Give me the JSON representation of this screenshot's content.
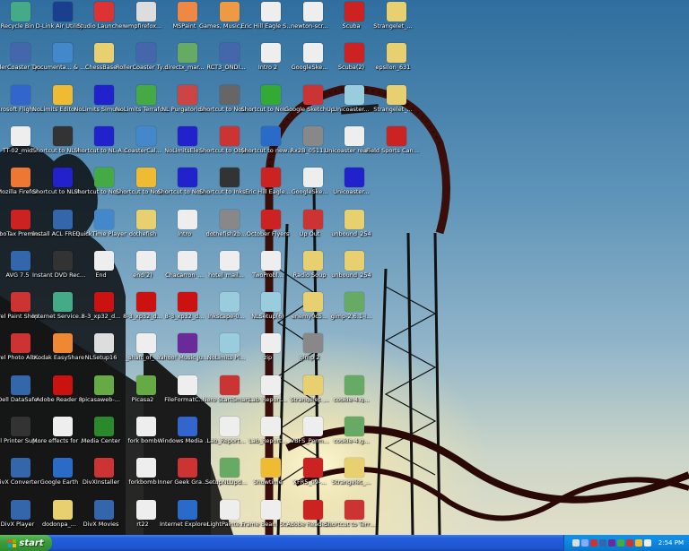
{
  "desktop": {
    "icons": [
      {
        "label": "Recycle Bin",
        "icon": "recycle-bin-icon",
        "color": "#4a8",
        "col": 0,
        "row": 0
      },
      {
        "label": "D-Link Air Utility",
        "icon": "dlink-icon",
        "color": "#1a3f8f",
        "col": 1,
        "row": 0
      },
      {
        "label": "Studio Launcher",
        "icon": "studio-icon",
        "color": "#d33",
        "col": 2,
        "row": 0
      },
      {
        "label": "wmpfirefox...",
        "icon": "window-icon",
        "color": "#ddd",
        "col": 3,
        "row": 0
      },
      {
        "label": "MSPaint",
        "icon": "paint-icon",
        "color": "#e84",
        "col": 4,
        "row": 0
      },
      {
        "label": "Games, Music, & Photos",
        "icon": "folder-icon",
        "color": "#e94",
        "col": 5,
        "row": 0
      },
      {
        "label": "Eric Hill Eagle Service Pr...",
        "icon": "document-icon",
        "color": "#eee",
        "col": 6,
        "row": 0
      },
      {
        "label": "newton-scr...",
        "icon": "document-icon",
        "color": "#eee",
        "col": 7,
        "row": 0
      },
      {
        "label": "Scuba",
        "icon": "pdf-icon",
        "color": "#c22",
        "col": 8,
        "row": 0
      },
      {
        "label": "Strangelet_...",
        "icon": "folder-icon",
        "color": "#e8d070",
        "col": 9,
        "row": 0
      },
      {
        "label": "RollerCoaster Tycoon® 3",
        "icon": "rct-icon",
        "color": "#46a",
        "col": 0,
        "row": 1
      },
      {
        "label": "Documenta... & Support",
        "icon": "help-icon",
        "color": "#48c",
        "col": 1,
        "row": 1
      },
      {
        "label": "ChessBase",
        "icon": "folder-icon",
        "color": "#e8d070",
        "col": 2,
        "row": 1
      },
      {
        "label": "RollerCoaster Tycoon® 3",
        "icon": "rct-icon",
        "color": "#46a",
        "col": 3,
        "row": 1
      },
      {
        "label": "directx_mar...",
        "icon": "setup-icon",
        "color": "#6a6",
        "col": 4,
        "row": 1
      },
      {
        "label": "RCT3_ONDI...",
        "icon": "rct-icon",
        "color": "#46a",
        "col": 5,
        "row": 1
      },
      {
        "label": "Intro 2",
        "icon": "document-icon",
        "color": "#eee",
        "col": 6,
        "row": 1
      },
      {
        "label": "GoogleSke...",
        "icon": "document-icon",
        "color": "#eee",
        "col": 7,
        "row": 1
      },
      {
        "label": "Scuba(2)",
        "icon": "pdf-icon",
        "color": "#c22",
        "col": 8,
        "row": 1
      },
      {
        "label": "epsilon_631",
        "icon": "folder-icon",
        "color": "#e8d070",
        "col": 9,
        "row": 1
      },
      {
        "label": "Microsoft Flight Si...",
        "icon": "plane-icon",
        "color": "#36c",
        "col": 0,
        "row": 2
      },
      {
        "label": "NoLimits Editor 1.6",
        "icon": "helmet-icon",
        "color": "#eb3",
        "col": 1,
        "row": 2
      },
      {
        "label": "NoLimits Simulator 1.6",
        "icon": "track-icon",
        "color": "#22c",
        "col": 2,
        "row": 2
      },
      {
        "label": "NoLimits Terrafor...",
        "icon": "terrain-icon",
        "color": "#4a4",
        "col": 3,
        "row": 2
      },
      {
        "label": "NL Purgatorium",
        "icon": "tools-icon",
        "color": "#c44",
        "col": 4,
        "row": 2
      },
      {
        "label": "Shortcut to NoLimitsCon...",
        "icon": "track-icon",
        "color": "#666",
        "col": 5,
        "row": 2
      },
      {
        "label": "Shortcut to NoLimits Tra...",
        "icon": "track-icon",
        "color": "#3a3",
        "col": 6,
        "row": 2
      },
      {
        "label": "Google SketchUp",
        "icon": "sketchup-icon",
        "color": "#c33",
        "col": 7,
        "row": 2
      },
      {
        "label": "Unicoaster...",
        "icon": "cd-icon",
        "color": "#9cd",
        "col": 8,
        "row": 2
      },
      {
        "label": "Strangelet_...",
        "icon": "folder-icon",
        "color": "#e8d070",
        "col": 9,
        "row": 2
      },
      {
        "label": "TT-02_mid",
        "icon": "document-icon",
        "color": "#eee",
        "col": 0,
        "row": 3
      },
      {
        "label": "Shortcut to NL-AHG ve...",
        "icon": "track-icon",
        "color": "#333",
        "col": 1,
        "row": 3
      },
      {
        "label": "Shortcut to NL-AHG Usa...",
        "icon": "track-icon",
        "color": "#22c",
        "col": 2,
        "row": 3
      },
      {
        "label": "CoasterCal...",
        "icon": "calc-icon",
        "color": "#48c",
        "col": 3,
        "row": 3
      },
      {
        "label": "NoLimitsEle...",
        "icon": "track-icon",
        "color": "#22c",
        "col": 4,
        "row": 3
      },
      {
        "label": "Shortcut to ObjectCreator",
        "icon": "shapes-icon",
        "color": "#c33",
        "col": 5,
        "row": 3
      },
      {
        "label": "Shortcut to newton",
        "icon": "newton-icon",
        "color": "#2a6ac8",
        "col": 6,
        "row": 3
      },
      {
        "label": "Rx2B_0511...",
        "icon": "image-icon",
        "color": "#888",
        "col": 7,
        "row": 3
      },
      {
        "label": "Unicoaster readme",
        "icon": "document-icon",
        "color": "#eee",
        "col": 8,
        "row": 3
      },
      {
        "label": "Field Sports Canpout",
        "icon": "pdf-icon",
        "color": "#c22",
        "col": 9,
        "row": 3
      },
      {
        "label": "Mozilla Firefox",
        "icon": "firefox-icon",
        "color": "#e73",
        "col": 0,
        "row": 4
      },
      {
        "label": "Shortcut to NL-Autofish...",
        "icon": "track-icon",
        "color": "#22c",
        "col": 1,
        "row": 4
      },
      {
        "label": "Shortcut to NoLimitsTer...",
        "icon": "terrain-icon",
        "color": "#4a4",
        "col": 2,
        "row": 4
      },
      {
        "label": "Shortcut to NoLimitsEditor",
        "icon": "helmet-icon",
        "color": "#eb3",
        "col": 3,
        "row": 4
      },
      {
        "label": "Shortcut to NoLimitsSim...",
        "icon": "track-icon",
        "color": "#22c",
        "col": 4,
        "row": 4
      },
      {
        "label": "Shortcut to Inkscape",
        "icon": "inkscape-icon",
        "color": "#333",
        "col": 5,
        "row": 4
      },
      {
        "label": "Eric Hill Eagle...",
        "icon": "pdf-icon",
        "color": "#c22",
        "col": 6,
        "row": 4
      },
      {
        "label": "GoogleSke...",
        "icon": "document-icon",
        "color": "#eee",
        "col": 7,
        "row": 4
      },
      {
        "label": "Unicoaster...",
        "icon": "track-icon",
        "color": "#22c",
        "col": 8,
        "row": 4
      },
      {
        "label": "TurboTax Premier 2007",
        "icon": "turbotax-icon",
        "color": "#c22",
        "col": 0,
        "row": 5
      },
      {
        "label": "Install ACL FREE Trial",
        "icon": "install-icon",
        "color": "#36a",
        "col": 1,
        "row": 5
      },
      {
        "label": "QuickTime Player",
        "icon": "quicktime-icon",
        "color": "#48c",
        "col": 2,
        "row": 5
      },
      {
        "label": "dothefish",
        "icon": "folder-icon",
        "color": "#e8d070",
        "col": 3,
        "row": 5
      },
      {
        "label": "Intro",
        "icon": "document-icon",
        "color": "#eee",
        "col": 4,
        "row": 5
      },
      {
        "label": "dothefish2b...",
        "icon": "image-icon",
        "color": "#888",
        "col": 5,
        "row": 5
      },
      {
        "label": "October Flyers",
        "icon": "pdf-icon",
        "color": "#c22",
        "col": 6,
        "row": 5
      },
      {
        "label": "Up Out",
        "icon": "sketchup-icon",
        "color": "#c33",
        "col": 7,
        "row": 5
      },
      {
        "label": "unbound_254",
        "icon": "folder-icon",
        "color": "#e8d070",
        "col": 8,
        "row": 5
      },
      {
        "label": "AVG 7.5",
        "icon": "avg-icon",
        "color": "#36a",
        "col": 0,
        "row": 6
      },
      {
        "label": "Instant DVD Recorder",
        "icon": "dvd-icon",
        "color": "#333",
        "col": 1,
        "row": 6
      },
      {
        "label": "End",
        "icon": "document-icon",
        "color": "#eee",
        "col": 2,
        "row": 6
      },
      {
        "label": "end(2)",
        "icon": "document-icon",
        "color": "#eee",
        "col": 3,
        "row": 6
      },
      {
        "label": "Chacarron_...",
        "icon": "document-icon",
        "color": "#eee",
        "col": 4,
        "row": 6
      },
      {
        "label": "hotel_mail...",
        "icon": "document-icon",
        "color": "#eee",
        "col": 5,
        "row": 6
      },
      {
        "label": "TwoProbl...",
        "icon": "document-icon",
        "color": "#eee",
        "col": 6,
        "row": 6
      },
      {
        "label": "Radio Soup",
        "icon": "folder-icon",
        "color": "#e8d070",
        "col": 7,
        "row": 6
      },
      {
        "label": "unbound_254",
        "icon": "folder-icon",
        "color": "#e8d070",
        "col": 8,
        "row": 6
      },
      {
        "label": "Corel Paint Shop Pro X",
        "icon": "corel-icon",
        "color": "#c33",
        "col": 0,
        "row": 7
      },
      {
        "label": "Internet Service Offers",
        "icon": "internet-icon",
        "color": "#4a8",
        "col": 1,
        "row": 7
      },
      {
        "label": "8-3_xp32_d...",
        "icon": "ati-icon",
        "color": "#c11",
        "col": 2,
        "row": 7
      },
      {
        "label": "8-3_xp32_d...",
        "icon": "ati-icon",
        "color": "#c11",
        "col": 3,
        "row": 7
      },
      {
        "label": "8-3_xp32_d...",
        "icon": "ati-icon",
        "color": "#c11",
        "col": 4,
        "row": 7
      },
      {
        "label": "Inkscape-0...",
        "icon": "cd-icon",
        "color": "#9cd",
        "col": 5,
        "row": 7
      },
      {
        "label": "NLSetup(6)",
        "icon": "cd-icon",
        "color": "#9cd",
        "col": 6,
        "row": 7
      },
      {
        "label": "enemy0c5...",
        "icon": "folder-icon",
        "color": "#e8d070",
        "col": 7,
        "row": 7
      },
      {
        "label": "gimp-2.6.1-i...",
        "icon": "setup-icon",
        "color": "#6a6",
        "col": 8,
        "row": 7
      },
      {
        "label": "Corel Photo Album 6",
        "icon": "corel-icon",
        "color": "#c33",
        "col": 0,
        "row": 8
      },
      {
        "label": "Kodak EasyShare",
        "icon": "kodak-icon",
        "color": "#e83",
        "col": 1,
        "row": 8
      },
      {
        "label": "NLSetup16",
        "icon": "window-icon",
        "color": "#ddd",
        "col": 2,
        "row": 8
      },
      {
        "label": "_shaft_of_...",
        "icon": "document-icon",
        "color": "#eee",
        "col": 3,
        "row": 8
      },
      {
        "label": "Yahoo! Music Jukebox",
        "icon": "yahoo-icon",
        "color": "#6a2a9a",
        "col": 4,
        "row": 8
      },
      {
        "label": "NoLimits Pl...",
        "icon": "cd-icon",
        "color": "#9cd",
        "col": 5,
        "row": 8
      },
      {
        "label": "zip",
        "icon": "document-icon",
        "color": "#eee",
        "col": 6,
        "row": 8
      },
      {
        "label": "gimp 2",
        "icon": "gimp-icon",
        "color": "#888",
        "col": 7,
        "row": 8
      },
      {
        "label": "Dell DataSafe",
        "icon": "dell-icon",
        "color": "#36a",
        "col": 0,
        "row": 9
      },
      {
        "label": "Adobe Reader 8",
        "icon": "adobe-icon",
        "color": "#c11",
        "col": 1,
        "row": 9
      },
      {
        "label": "picasaweb-...",
        "icon": "picasa-icon",
        "color": "#6a4",
        "col": 2,
        "row": 9
      },
      {
        "label": "Picasa2",
        "icon": "picasa-icon",
        "color": "#6a4",
        "col": 3,
        "row": 9
      },
      {
        "label": "FileFormatC...",
        "icon": "document-icon",
        "color": "#eee",
        "col": 4,
        "row": 9
      },
      {
        "label": "Nero StartSmart",
        "icon": "nero-icon",
        "color": "#c33",
        "col": 5,
        "row": 9
      },
      {
        "label": "Lab_Report...",
        "icon": "document-icon",
        "color": "#eee",
        "col": 6,
        "row": 9
      },
      {
        "label": "Strangelet_...",
        "icon": "folder-icon",
        "color": "#e8d070",
        "col": 7,
        "row": 9
      },
      {
        "label": "cookie-4.g...",
        "icon": "setup-icon",
        "color": "#6a6",
        "col": 8,
        "row": 9
      },
      {
        "label": "Dell Printer Supplies ...",
        "icon": "printer-icon",
        "color": "#333",
        "col": 0,
        "row": 10
      },
      {
        "label": "More effects for your video",
        "icon": "video-icon",
        "color": "#eee",
        "col": 1,
        "row": 10
      },
      {
        "label": "Media Center",
        "icon": "mediacenter-icon",
        "color": "#2a8a2a",
        "col": 2,
        "row": 10
      },
      {
        "label": "fork bomb",
        "icon": "document-icon",
        "color": "#eee",
        "col": 3,
        "row": 10
      },
      {
        "label": "Windows Media Player",
        "icon": "wmp-icon",
        "color": "#36c",
        "col": 4,
        "row": 10
      },
      {
        "label": "Lab_Report...",
        "icon": "document-icon",
        "color": "#eee",
        "col": 5,
        "row": 10
      },
      {
        "label": "Lab_Report...",
        "icon": "document-icon",
        "color": "#eee",
        "col": 6,
        "row": 10
      },
      {
        "label": "VBFS_Perm...",
        "icon": "document-icon",
        "color": "#eee",
        "col": 7,
        "row": 10
      },
      {
        "label": "cookie-4.g...",
        "icon": "setup-icon",
        "color": "#6a6",
        "col": 8,
        "row": 10
      },
      {
        "label": "DivX Converter",
        "icon": "divx-icon",
        "color": "#36a",
        "col": 0,
        "row": 11
      },
      {
        "label": "Google Earth",
        "icon": "earth-icon",
        "color": "#2a6ac8",
        "col": 1,
        "row": 11
      },
      {
        "label": "DivXInstaller",
        "icon": "divx-icon",
        "color": "#c33",
        "col": 2,
        "row": 11
      },
      {
        "label": "forkbomb",
        "icon": "document-icon",
        "color": "#eee",
        "col": 3,
        "row": 11
      },
      {
        "label": "Inner Geek Grand Illus...",
        "icon": "document-icon",
        "color": "#c33",
        "col": 4,
        "row": 11
      },
      {
        "label": "SetupNLUpd...",
        "icon": "setup-icon",
        "color": "#6a6",
        "col": 5,
        "row": 11
      },
      {
        "label": "Showtime",
        "icon": "showtime-icon",
        "color": "#eb3",
        "col": 6,
        "row": 11
      },
      {
        "label": "XFR5_09-...",
        "icon": "pdf-icon",
        "color": "#c22",
        "col": 7,
        "row": 11
      },
      {
        "label": "Strangelet_...",
        "icon": "folder-icon",
        "color": "#e8d070",
        "col": 8,
        "row": 11
      },
      {
        "label": "DivX Player",
        "icon": "divx-icon",
        "color": "#36a",
        "col": 0,
        "row": 12
      },
      {
        "label": "dodonpa_...",
        "icon": "folder-icon",
        "color": "#e8d070",
        "col": 1,
        "row": 12
      },
      {
        "label": "DivX Movies",
        "icon": "divx-icon",
        "color": "#36a",
        "col": 2,
        "row": 12
      },
      {
        "label": "rt22",
        "icon": "document-icon",
        "color": "#eee",
        "col": 3,
        "row": 12
      },
      {
        "label": "Internet Explorer",
        "icon": "ie-icon",
        "color": "#2a6ac8",
        "col": 4,
        "row": 12
      },
      {
        "label": "LightPainte...",
        "icon": "document-icon",
        "color": "#eee",
        "col": 5,
        "row": 12
      },
      {
        "label": "Frame Beam Stop...",
        "icon": "document-icon",
        "color": "#eee",
        "col": 6,
        "row": 12
      },
      {
        "label": "Adobe Reader...",
        "icon": "pdf-icon",
        "color": "#c22",
        "col": 7,
        "row": 12
      },
      {
        "label": "Shortcut to Terror...",
        "icon": "nolimits-icon",
        "color": "#c33",
        "col": 8,
        "row": 12
      }
    ]
  },
  "taskbar": {
    "start_label": "start",
    "clock": "2:54 PM",
    "tray_icons": [
      {
        "icon": "network-icon",
        "color": "#ddd"
      },
      {
        "icon": "volume-icon",
        "color": "#8af"
      },
      {
        "icon": "avg-tray-icon",
        "color": "#c33"
      },
      {
        "icon": "dell-tray-icon",
        "color": "#36a"
      },
      {
        "icon": "yahoo-tray-icon",
        "color": "#6a2a9a"
      },
      {
        "icon": "safely-remove-icon",
        "color": "#4a4"
      },
      {
        "icon": "security-icon",
        "color": "#c33"
      },
      {
        "icon": "update-icon",
        "color": "#eb3"
      },
      {
        "icon": "speaker-icon",
        "color": "#eee"
      }
    ]
  }
}
